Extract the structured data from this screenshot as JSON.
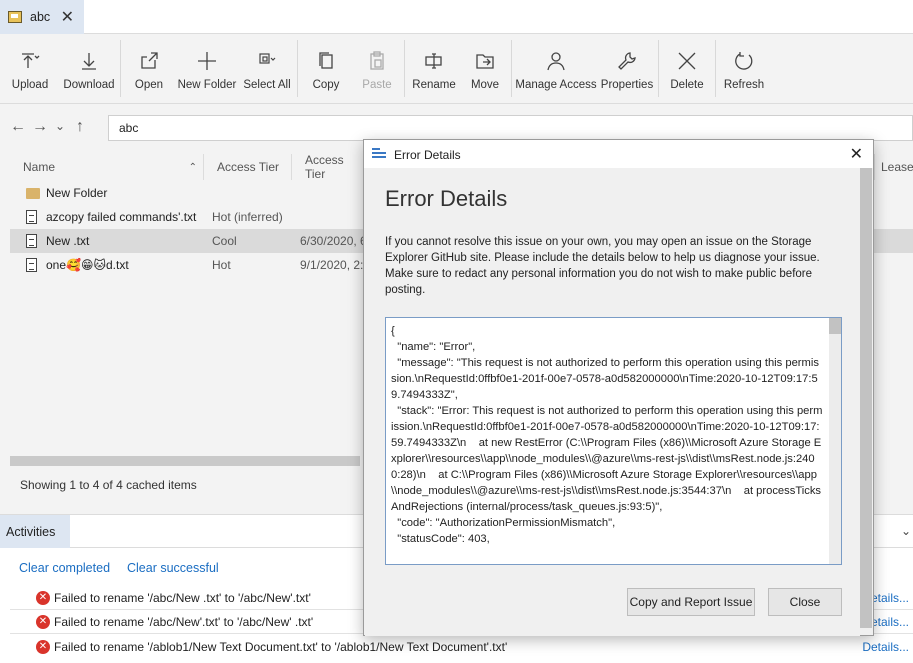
{
  "tab": {
    "label": "abc",
    "close": "✕"
  },
  "toolbar": {
    "upload": "Upload",
    "download": "Download",
    "open": "Open",
    "new_folder": "New Folder",
    "select_all": "Select All",
    "copy": "Copy",
    "paste": "Paste",
    "rename": "Rename",
    "move": "Move",
    "manage_access": "Manage Access",
    "properties": "Properties",
    "delete": "Delete",
    "refresh": "Refresh"
  },
  "address": {
    "path": "abc"
  },
  "columns": {
    "name": "Name",
    "access_tier": "Access Tier",
    "access_tier_2": "Access Tier",
    "lease": "Lease"
  },
  "files": [
    {
      "name": "New Folder",
      "tier": "",
      "date": ""
    },
    {
      "name": "azcopy failed commands'.txt",
      "tier": "Hot (inferred)",
      "date": ""
    },
    {
      "name": "New .txt",
      "tier": "Cool",
      "date": "6/30/2020, 6"
    },
    {
      "name": "one🥰😁🐱d.txt",
      "tier": "Hot",
      "date": "9/1/2020, 2:"
    }
  ],
  "status": {
    "showing": "Showing 1 to 4 of 4 cached items"
  },
  "activities": {
    "tab": "Activities",
    "clear_completed": "Clear completed",
    "clear_successful": "Clear successful",
    "items": [
      {
        "text": "Failed to rename '/abc/New .txt' to '/abc/New'.txt'",
        "details": "Details..."
      },
      {
        "text": "Failed to rename '/abc/New'.txt' to '/abc/New' .txt'",
        "details": "Details..."
      },
      {
        "text": "Failed to rename '/ablob1/New Text Document.txt' to '/ablob1/New Text Document'.txt'",
        "details": "Details..."
      }
    ]
  },
  "dialog": {
    "title": "Error Details",
    "heading": "Error Details",
    "description": "If you cannot resolve this issue on your own, you may open an issue on the Storage Explorer GitHub site. Please include the details below to help us diagnose your issue. Make sure to redact any personal information you do not wish to make public before posting.",
    "code": "{\n  \"name\": \"Error\",\n  \"message\": \"This request is not authorized to perform this operation using this permission.\\nRequestId:0ffbf0e1-201f-00e7-0578-a0d582000000\\nTime:2020-10-12T09:17:59.7494333Z\",\n  \"stack\": \"Error: This request is not authorized to perform this operation using this permission.\\nRequestId:0ffbf0e1-201f-00e7-0578-a0d582000000\\nTime:2020-10-12T09:17:59.7494333Z\\n    at new RestError (C:\\\\Program Files (x86)\\\\Microsoft Azure Storage Explorer\\\\resources\\\\app\\\\node_modules\\\\@azure\\\\ms-rest-js\\\\dist\\\\msRest.node.js:2400:28)\\n    at C:\\\\Program Files (x86)\\\\Microsoft Azure Storage Explorer\\\\resources\\\\app\\\\node_modules\\\\@azure\\\\ms-rest-js\\\\dist\\\\msRest.node.js:3544:37\\n    at processTicksAndRejections (internal/process/task_queues.js:93:5)\",\n  \"code\": \"AuthorizationPermissionMismatch\",\n  \"statusCode\": 403,",
    "report_button": "Copy and Report Issue",
    "close_button": "Close",
    "close_icon": "✕"
  },
  "colors": {
    "accent_tab": "#dde6f2",
    "link": "#1a6dc2",
    "error": "#d9342b"
  }
}
